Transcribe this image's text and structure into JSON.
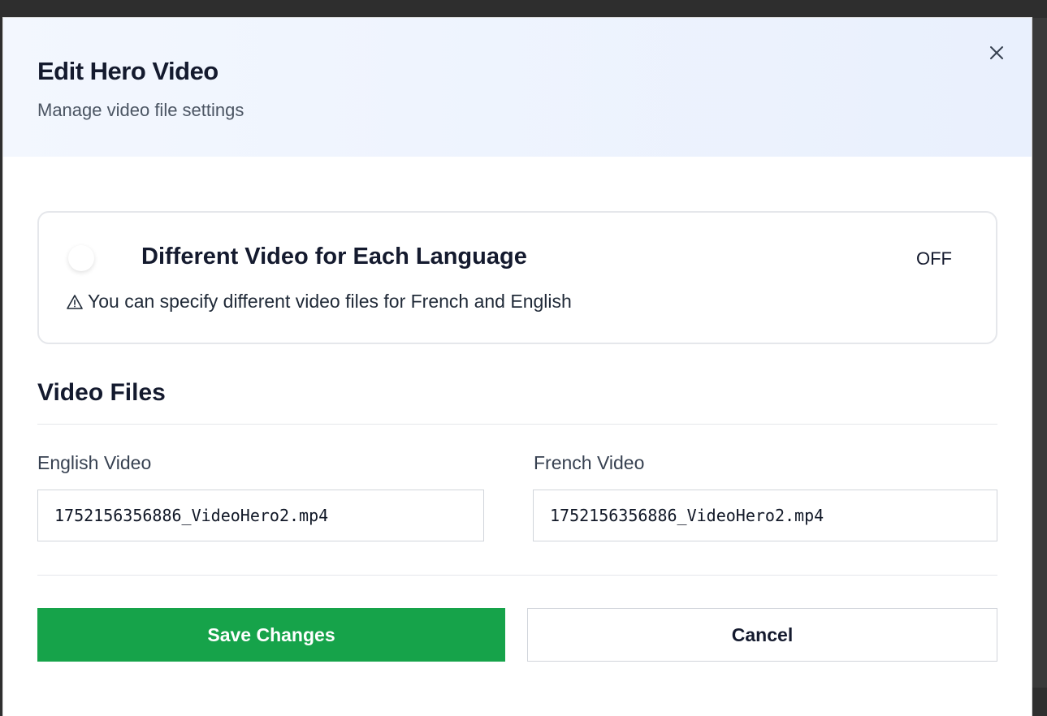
{
  "modal": {
    "title": "Edit Hero Video",
    "subtitle": "Manage video file settings",
    "close_icon": "close-icon"
  },
  "language_toggle": {
    "label": "Different Video for Each Language",
    "state": "OFF",
    "enabled": false,
    "hint": "You can specify different video files for French and English",
    "hint_icon": "warning-icon"
  },
  "video_files": {
    "section_title": "Video Files",
    "english": {
      "label": "English Video",
      "value": "1752156356886_VideoHero2.mp4"
    },
    "french": {
      "label": "French Video",
      "value": "1752156356886_VideoHero2.mp4"
    }
  },
  "actions": {
    "save_label": "Save Changes",
    "cancel_label": "Cancel"
  },
  "colors": {
    "primary": "#16a34a",
    "header_bg": "#edf2fd",
    "text_dark": "#141a2e"
  }
}
